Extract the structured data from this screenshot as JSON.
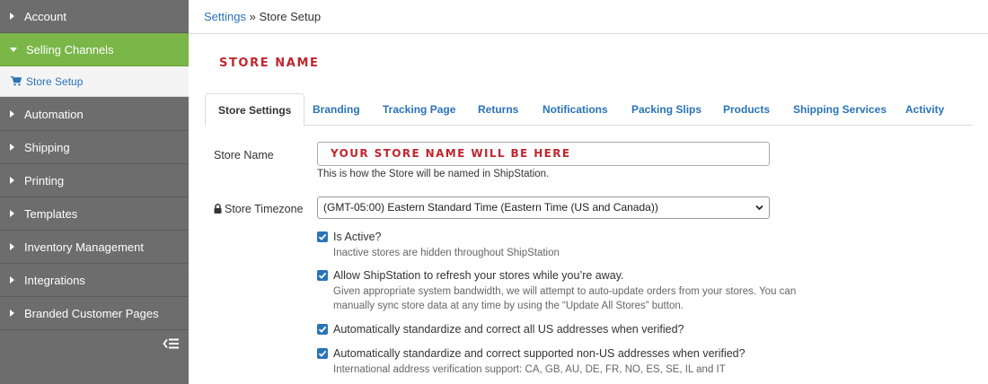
{
  "sidebar": {
    "items": [
      {
        "label": "Account",
        "active": false
      },
      {
        "label": "Selling Channels",
        "active": true
      },
      {
        "label": "Automation",
        "active": false
      },
      {
        "label": "Shipping",
        "active": false
      },
      {
        "label": "Printing",
        "active": false
      },
      {
        "label": "Templates",
        "active": false
      },
      {
        "label": "Inventory Management",
        "active": false
      },
      {
        "label": "Integrations",
        "active": false
      },
      {
        "label": "Branded Customer Pages",
        "active": false
      }
    ],
    "subitem": {
      "label": "Store Setup",
      "icon": "cart-icon"
    },
    "collapse_icon": "collapse-menu-icon"
  },
  "breadcrumb": {
    "parent": "Settings",
    "separator": " » ",
    "current": "Store Setup"
  },
  "page": {
    "store_title": "STORE NAME"
  },
  "tabs": [
    {
      "label": "Store Settings",
      "active": true
    },
    {
      "label": "Branding",
      "active": false
    },
    {
      "label": "Tracking Page",
      "active": false
    },
    {
      "label": "Returns",
      "active": false
    },
    {
      "label": "Notifications",
      "active": false
    },
    {
      "label": "Packing Slips",
      "active": false
    },
    {
      "label": "Products",
      "active": false
    },
    {
      "label": "Shipping Services",
      "active": false
    },
    {
      "label": "Activity",
      "active": false
    }
  ],
  "form": {
    "store_name_label": "Store Name",
    "store_name_value": "YOUR STORE NAME WILL BE HERE",
    "store_name_help": "This is how the Store will be named in ShipStation.",
    "timezone_label": "Store Timezone",
    "timezone_value": "(GMT-05:00) Eastern Standard Time (Eastern Time (US and Canada))",
    "checkboxes": [
      {
        "label": "Is Active?",
        "checked": true,
        "desc": "Inactive stores are hidden throughout ShipStation"
      },
      {
        "label": "Allow ShipStation to refresh your stores while you’re away.",
        "checked": true,
        "desc": "Given appropriate system bandwidth, we will attempt to auto-update orders from your stores. You can manually sync store data at any time by using the “Update All Stores” button."
      },
      {
        "label": "Automatically standardize and correct all US addresses when verified?",
        "checked": true,
        "desc": ""
      },
      {
        "label": "Automatically standardize and correct supported non-US addresses when verified?",
        "checked": true,
        "desc": "International address verification support: CA, GB, AU, DE, FR, NO, ES, SE, IL and IT"
      }
    ]
  },
  "colors": {
    "sidebar_bg": "#6d6d6d",
    "active_green": "#7ab648",
    "link_blue": "#2a73b8",
    "brand_red": "#c0262d"
  }
}
